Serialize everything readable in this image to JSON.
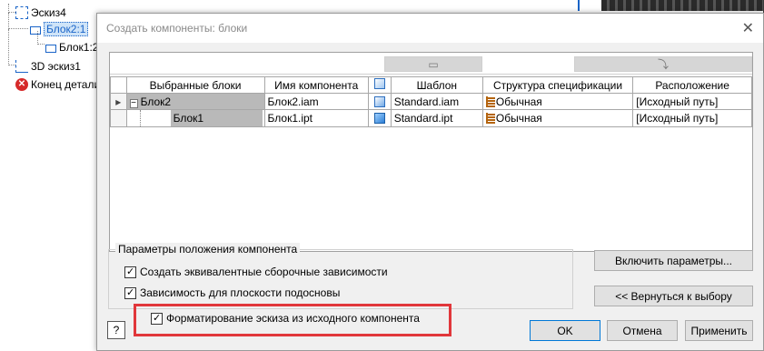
{
  "tree": {
    "items": [
      {
        "label": "Эскиз4",
        "icon": "sketch-icon"
      },
      {
        "label": "Блок2:1",
        "icon": "block-icon",
        "selected": true
      },
      {
        "label": "Блок1:2",
        "icon": "block-icon"
      },
      {
        "label": "3D эскиз1",
        "icon": "sketch-3d-icon"
      },
      {
        "label": "Конец детали",
        "icon": "end-of-part-icon"
      }
    ]
  },
  "dialog": {
    "title": "Создать компоненты: блоки",
    "close_glyph": "✕",
    "toolbar": {
      "btn1_glyph": "▭",
      "btn2_glyph": "⤵"
    },
    "grid": {
      "columns": [
        "Выбранные блоки",
        "Имя компонента",
        "",
        "Шаблон",
        "Структура спецификации",
        "Расположение"
      ],
      "rows": [
        {
          "marker": "▸",
          "expander": "−",
          "block": "Блок2",
          "component": "Блок2.iam",
          "icon": "assembly-icon",
          "template": "Standard.iam",
          "bom": "Обычная",
          "location": "[Исходный путь]"
        },
        {
          "marker": "",
          "expander": "",
          "block": "Блок1",
          "component": "Блок1.ipt",
          "icon": "part-icon",
          "template": "Standard.ipt",
          "bom": "Обычная",
          "location": "[Исходный путь]"
        }
      ]
    },
    "group": {
      "legend": "Параметры положения компонента",
      "options": [
        {
          "label": "Создать эквивалентные сборочные зависимости",
          "checked": true
        },
        {
          "label": "Зависимость для плоскости подосновы",
          "checked": true
        }
      ]
    },
    "format_option": {
      "label": "Форматирование эскиза из исходного компонента",
      "checked": true
    },
    "buttons": {
      "include_params": "Включить параметры...",
      "back_to_selection": "<< Вернуться к выбору",
      "ok": "OK",
      "cancel": "Отмена",
      "apply": "Применить",
      "help": "?"
    },
    "colors": {
      "highlight": "#e1373b",
      "accent": "#0078d7"
    }
  }
}
